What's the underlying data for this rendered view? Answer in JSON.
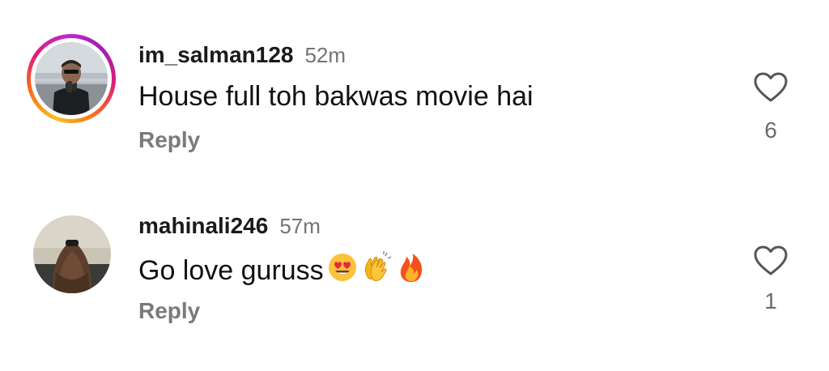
{
  "comments": [
    {
      "username": "im_salman128",
      "time": "52m",
      "text": "House full toh bakwas movie hai",
      "reply_label": "Reply",
      "likes": "6",
      "has_story_ring": true
    },
    {
      "username": "mahinali246",
      "time": "57m",
      "text": "Go love guruss",
      "emojis": [
        "heart-eyes-emoji",
        "clapping-hands-emoji",
        "fire-emoji"
      ],
      "reply_label": "Reply",
      "likes": "1",
      "has_story_ring": false
    }
  ],
  "colors": {
    "username": "#1a1a1a",
    "meta": "#737373",
    "reply": "#7a7a7a",
    "icon": "#555555",
    "ring_start": "#fbbf24",
    "ring_end": "#c026d3"
  }
}
